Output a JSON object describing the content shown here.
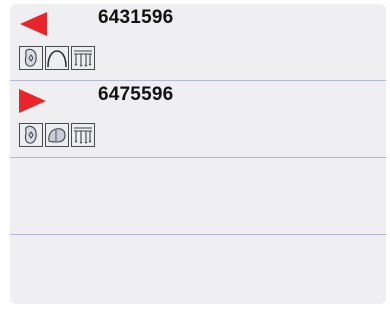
{
  "rows": [
    {
      "number": "6431596",
      "arrow": "left-arrow-icon",
      "arrow_color": "#e8252b",
      "icons": [
        "rear-tooth-icon",
        "arch-curve-icon",
        "tooth-grid-icon"
      ]
    },
    {
      "number": "6475596",
      "arrow": "right-arrow-icon",
      "arrow_color": "#e8252b",
      "icons": [
        "rear-tooth-icon",
        "tooth-shape-icon",
        "tooth-grid-icon"
      ]
    }
  ],
  "empty_rows": 2,
  "colors": {
    "panel_bg": "#efeff1",
    "divider": "#b4b8d6",
    "accent": "#e8252b"
  }
}
